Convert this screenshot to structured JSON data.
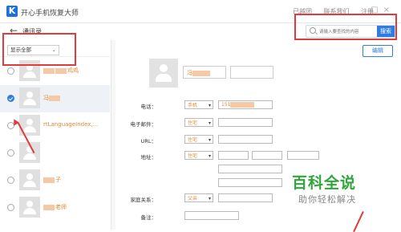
{
  "app": {
    "logo_letter": "K",
    "title": "开心手机恢复大师"
  },
  "top_menu": [
    "已越团",
    "联系我们",
    "注册"
  ],
  "window_controls": [
    "-",
    "□",
    "×"
  ],
  "breadcrumb": "通讯录",
  "search": {
    "placeholder": "请输入要查找的内容",
    "button_label": "搜索"
  },
  "filter": {
    "selected": "显示全部"
  },
  "contacts": [
    {
      "name": "冯",
      "suffix": "鸡鸡",
      "checked": false,
      "selected": false
    },
    {
      "name": "冯",
      "suffix": "",
      "checked": true,
      "selected": true
    },
    {
      "name": "rtLanguageIndex,...",
      "suffix": "",
      "checked": false,
      "selected": false
    },
    {
      "name": "",
      "suffix": "",
      "checked": false,
      "selected": false
    },
    {
      "name": "子",
      "suffix": "",
      "checked": false,
      "selected": false
    },
    {
      "name": "老师",
      "suffix": "",
      "checked": false,
      "selected": false
    }
  ],
  "edit_button": "编辑",
  "detail": {
    "name_value": "冯",
    "phone": {
      "label": "电话：",
      "type": "手机",
      "value": "151"
    },
    "email": {
      "label": "电子邮件：",
      "type": "住宅"
    },
    "url": {
      "label": "URL：",
      "type": "住宅"
    },
    "address": {
      "label": "地址：",
      "type": "住宅"
    },
    "family": {
      "label": "家庭关系：",
      "type": "父亲"
    },
    "note": {
      "label": "备注："
    }
  },
  "watermark": {
    "title": "百科全说",
    "subtitle": "助你轻松解决"
  },
  "colors": {
    "accent": "#2f7de1",
    "highlight_red": "#e23b3b",
    "name_orange": "#e8862a",
    "watermark_green": "#2fa53a"
  }
}
